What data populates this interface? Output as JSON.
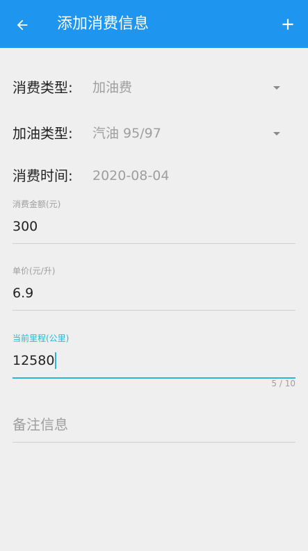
{
  "appbar": {
    "title": "添加消费信息",
    "back_icon": "arrow-back-icon",
    "add_icon": "plus-icon",
    "color": "#1e96f0"
  },
  "rows": [
    {
      "label": "消费类型:",
      "value": "加油费"
    },
    {
      "label": "加油类型:",
      "value": "汽油 95/97"
    },
    {
      "label": "消费时间:",
      "value": "2020-08-04"
    }
  ],
  "fields": [
    {
      "label": "消费金额(元)",
      "value": "300"
    },
    {
      "label": "单价(元/升)",
      "value": "6.9"
    },
    {
      "label": "当前里程(公里)",
      "value": "12580",
      "counter": "5 / 10"
    }
  ],
  "remark": {
    "placeholder": "备注信息"
  },
  "accent": "#2bb5d6"
}
